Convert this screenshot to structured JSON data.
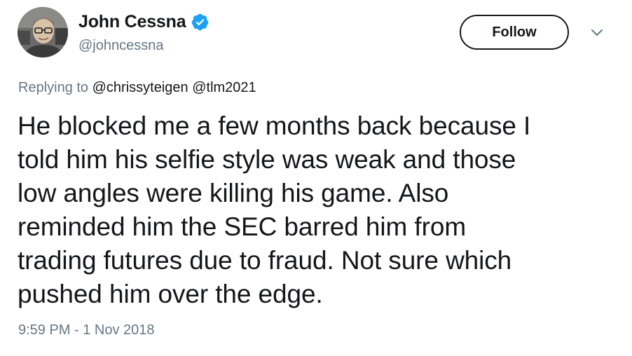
{
  "user": {
    "display_name": "John Cessna",
    "handle": "@johncessna",
    "verified": true,
    "verified_icon": "verified-badge-icon",
    "avatar_icon": "avatar"
  },
  "actions": {
    "follow_label": "Follow",
    "caret_icon": "chevron-down-icon"
  },
  "reply": {
    "prefix": "Replying to",
    "mentions": [
      "@chrissyteigen",
      "@tlm2021"
    ]
  },
  "tweet": {
    "lines": [
      "He blocked me a few months back because I",
      "told him his selfie style was weak and those",
      "low angles were killing his game. Also",
      "reminded him the SEC barred him from",
      "trading futures due to fraud. Not sure which",
      "pushed him over the edge."
    ]
  },
  "timestamp": "9:59 PM - 1 Nov 2018",
  "colors": {
    "text": "#14171a",
    "secondary": "#657786",
    "verified": "#1da1f2"
  }
}
